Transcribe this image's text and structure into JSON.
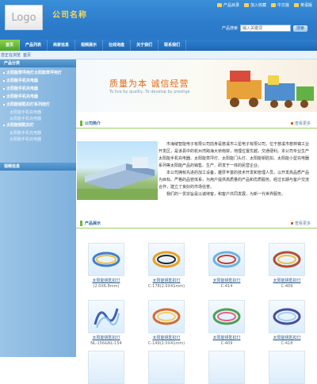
{
  "header": {
    "logo_text": "Logo",
    "company_name": "公司名称",
    "top_links": [
      "产品目录",
      "加入收藏",
      "中文版",
      "英语版"
    ],
    "search_label": "产品搜索",
    "search_value": "输入关键词",
    "search_button": "搜索"
  },
  "nav": {
    "items": [
      "首页",
      "产品列表",
      "商家信息",
      "视频展示",
      "在线询盘",
      "关于我们",
      "联系我们"
    ]
  },
  "breadcrumb": {
    "prefix": "您正在浏览",
    "current": "首页"
  },
  "sidebar": {
    "title": "产品分类",
    "items": [
      {
        "label": "太阳能草坪用灯太阳能草坪用灯",
        "subs": []
      },
      {
        "label": "太阳能手机充电器",
        "subs": []
      },
      {
        "label": "太阳能手机充电器",
        "subs": []
      },
      {
        "label": "太阳能手机充电器",
        "subs": []
      },
      {
        "label": "太阳能钥匙扣灯系列挂灯",
        "subs": [
          "太阳能手机充电器",
          "太阳能手机充电器"
        ]
      },
      {
        "label": "太阳能钥匙扣灯",
        "subs": [
          "太阳能手机充电器",
          "太阳能手机充电器"
        ]
      }
    ],
    "video_title": "视频信息"
  },
  "banner": {
    "title": "质量为本  诚信经营",
    "subtitle": "To live by quality, To develop by prestige"
  },
  "intro": {
    "title": "公司简介",
    "more": "查看更多",
    "paragraphs": [
      "市海缝智能电子有限公司前身是慈溪市三星电子有限公司，位于慈溪市慈林镇工业开发区，是该县中的杭州湾跨海大桥南岸，地理位置优越，交通便利。本公司专业生产太阳能手机充电器、太阳能草坪灯、太阳能门头灯、太阳能钥匙扣、太阳能小型充电器系列等太阳能产品的销售、生产、研发于一体的民营企业。",
      "本公司拥有先进的加工设备，雄厚丰富的技术开发和管理人员，以开发高品质产品为目标。严格的品管体系，为用户提供高质量的产品和优质服务。经过长期与客户交流合作，建立了良好的市场信誉。",
      "我们的一贯宗旨是以诚待客，和客户共同发展，为新一代世界服务。"
    ]
  },
  "products": {
    "title": "产品展示",
    "more": "查看更多",
    "row1": [
      {
        "name": "太阳能钥匙扣灯",
        "code": "(2.0X6.8mm)"
      },
      {
        "name": "太阳能钥匙扣灯",
        "code": "C-178(2.0X41mm)"
      },
      {
        "name": "太阳能钥匙扣灯",
        "code": "C-414"
      },
      {
        "name": "太阳能钥匙扣灯",
        "code": "C-409"
      }
    ],
    "row2": [
      {
        "name": "太阳能钥匙扣灯",
        "code": "NL-156&NL-154"
      },
      {
        "name": "太阳能钥匙扣灯",
        "code": "C-149(2.0X41mm)"
      },
      {
        "name": "太阳能钥匙扣灯",
        "code": "C-409"
      },
      {
        "name": "太阳能钥匙扣灯",
        "code": "C-418"
      }
    ]
  },
  "colors": {
    "header_blue": "#2c7ccc",
    "nav_active_green": "#5bb233",
    "company_gold": "#f6d65c",
    "section_title_blue": "#2c6aa6"
  }
}
